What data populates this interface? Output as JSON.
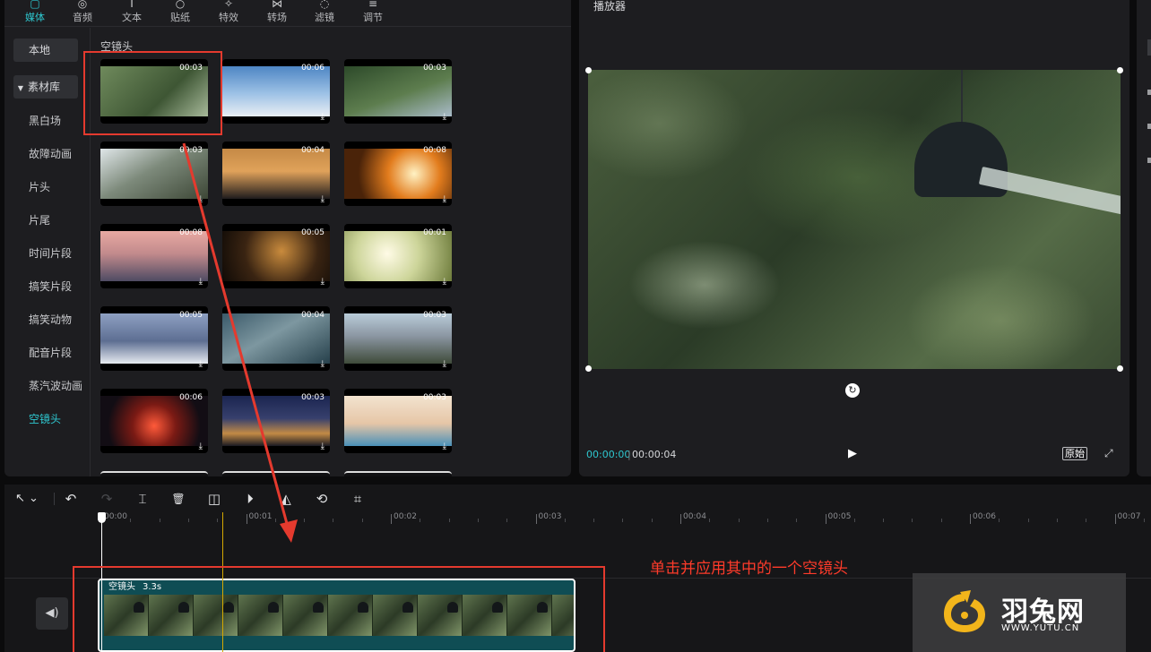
{
  "top_tabs": [
    {
      "label": "媒体",
      "icon": "media-icon",
      "glyph": "▢"
    },
    {
      "label": "音频",
      "icon": "audio-icon",
      "glyph": "◎"
    },
    {
      "label": "文本",
      "icon": "text-icon",
      "glyph": "T"
    },
    {
      "label": "贴纸",
      "icon": "sticker-icon",
      "glyph": "○"
    },
    {
      "label": "特效",
      "icon": "effects-icon",
      "glyph": "✧"
    },
    {
      "label": "转场",
      "icon": "transition-icon",
      "glyph": "⋈"
    },
    {
      "label": "滤镜",
      "icon": "filter-icon",
      "glyph": "◌"
    },
    {
      "label": "调节",
      "icon": "adjust-icon",
      "glyph": "≡"
    }
  ],
  "sidebar": {
    "local_label": "本地",
    "library_label": "素材库",
    "items": [
      "黑白场",
      "故障动画",
      "片头",
      "片尾",
      "时间片段",
      "搞笑片段",
      "搞笑动物",
      "配音片段",
      "蒸汽波动画",
      "空镜头"
    ]
  },
  "media": {
    "section_title": "空镜头",
    "download_glyph": "⤓",
    "thumbnails": [
      {
        "duration": "00:03",
        "download": false,
        "bg": "linear-gradient(135deg,#6f8a5c,#3e5634 60%,#a7b99a)"
      },
      {
        "duration": "00:06",
        "download": true,
        "bg": "linear-gradient(180deg,#4e86c4,#9ec2e6 55%,#e9eef3)"
      },
      {
        "duration": "00:03",
        "download": true,
        "bg": "linear-gradient(160deg,#2d4a2a,#5d7d4e 55%,#a9bbc9)"
      },
      {
        "duration": "00:03",
        "download": true,
        "bg": "linear-gradient(150deg,#dfe6e8,#7d8a7b 45%,#3d4736)"
      },
      {
        "duration": "00:04",
        "download": true,
        "bg": "linear-gradient(180deg,#c58a46,#e0a25a 45%,#1f1c1d)"
      },
      {
        "duration": "00:08",
        "download": true,
        "bg": "radial-gradient(circle at 65% 50%,#fff2c4,#e27c1d 35%,#4a2309 75%)"
      },
      {
        "duration": "00:08",
        "download": true,
        "bg": "linear-gradient(180deg,#e8a9a2,#c28a8c 45%,#4e4b63)"
      },
      {
        "duration": "00:05",
        "download": true,
        "bg": "radial-gradient(circle at 55% 40%,#c98b3d,#3a2412 55%,#0f0a06)"
      },
      {
        "duration": "00:01",
        "download": true,
        "bg": "radial-gradient(circle at 40% 45%,#fffbe6,#cdd59a 45%,#6d7b3b)"
      },
      {
        "duration": "00:05",
        "download": true,
        "bg": "linear-gradient(180deg,#8ea0c2,#5d6e92 55%,#e6eaf0)"
      },
      {
        "duration": "00:04",
        "download": true,
        "bg": "linear-gradient(150deg,#3b5a6a,#7d97a0 45%,#26404b)"
      },
      {
        "duration": "00:03",
        "download": true,
        "bg": "linear-gradient(180deg,#b9ccd9,#8b96a2 45%,#3f4b3a)"
      },
      {
        "duration": "00:06",
        "download": true,
        "bg": "radial-gradient(circle at 50% 60%,#ff5a3a,#7a1a14 35%,#120d14 75%)"
      },
      {
        "duration": "00:03",
        "download": true,
        "bg": "linear-gradient(180deg,#1b2550,#37406d 45%,#c28a45 75%,#1a1a22)"
      },
      {
        "duration": "00:03",
        "download": true,
        "bg": "linear-gradient(180deg,#f2e3cf,#e6c6a7 55%,#4a90b8)"
      }
    ]
  },
  "player": {
    "title": "播放器",
    "current_time": "00:00:00",
    "separator": "|",
    "total_time": "00:00:04",
    "original_label": "原始",
    "play_glyph": "▶",
    "fullscreen_glyph": "⤢",
    "rotate_glyph": "↻"
  },
  "toolbar": {
    "select_glyph": "↖ ⌄",
    "undo_glyph": "↶",
    "redo_glyph": "↷",
    "split_glyph": "⌶",
    "delete_glyph": "🗑",
    "freeze_glyph": "◫",
    "reverse_glyph": "⏵",
    "mirror_glyph": "◭",
    "rotate_glyph": "⟲",
    "crop_glyph": "⌗"
  },
  "ruler": [
    "00:00",
    "00:01",
    "00:02",
    "00:03",
    "00:04",
    "00:05",
    "00:06",
    "00:07"
  ],
  "clip": {
    "name": "空镜头",
    "duration": "3.3s"
  },
  "audio_glyph": "◀)",
  "annotation": {
    "text": "单击并应用其中的一个空镜头",
    "color": "#ff3b2a"
  },
  "watermark": {
    "brand": "羽兔网",
    "url": "WWW.YUTU.CN"
  },
  "colors": {
    "accent": "#2ec7cf",
    "panel": "#1d1d20",
    "clip": "#0f4d54",
    "playhead": "#d4a800"
  }
}
